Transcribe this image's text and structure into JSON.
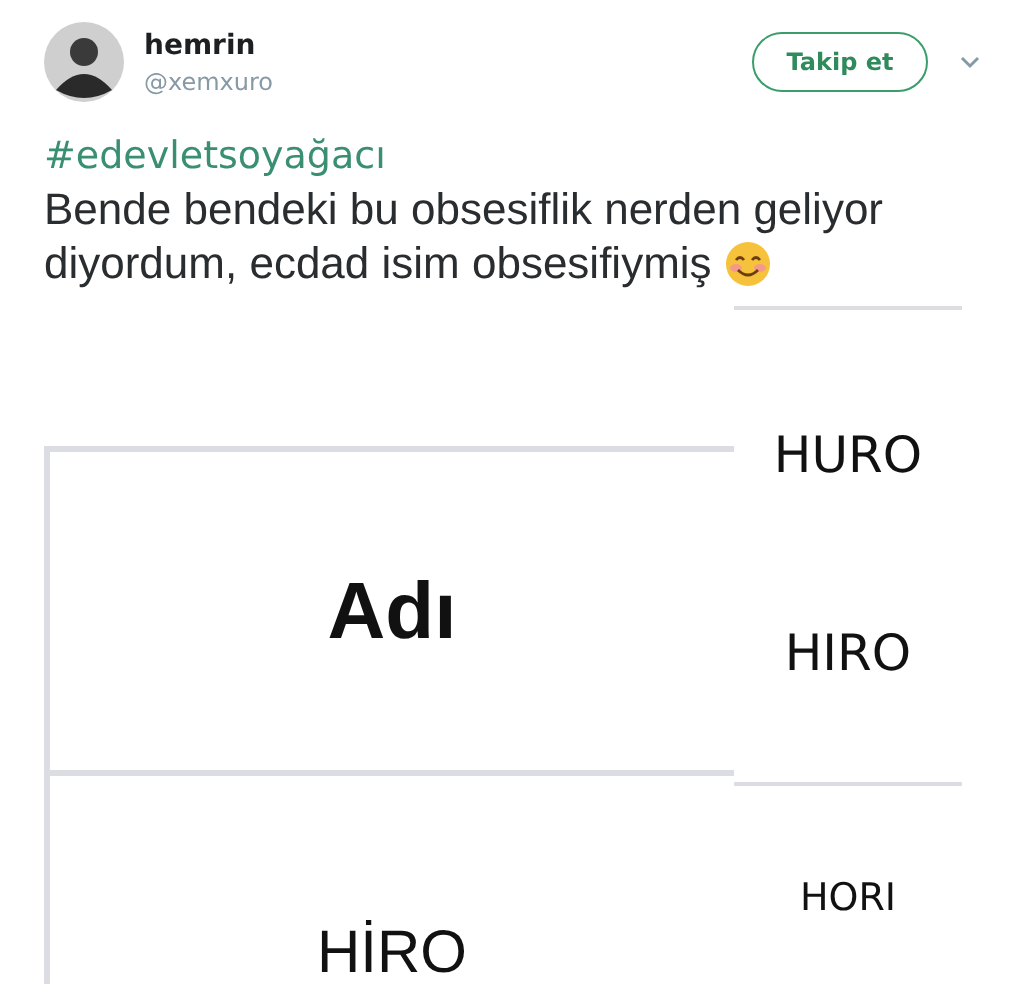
{
  "tweet": {
    "author": "hemrin",
    "handle": "@xemxuro",
    "follow_button": "Takip et",
    "hashtag": "#edevletsoyağacı",
    "text_lines": [
      "Bende bendeki bu obsesiflik nerden geliyor",
      "diyordum, ecdad isim obsesifiymiş"
    ]
  },
  "attached_image": {
    "header": "Adı",
    "value": "HİRO",
    "right_cells": [
      {
        "texts": [
          "HURO",
          "HIRO"
        ]
      },
      {
        "texts": [
          "HORI"
        ]
      }
    ]
  }
}
